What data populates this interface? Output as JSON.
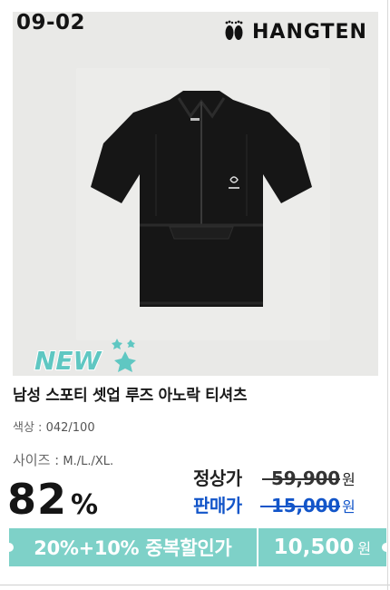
{
  "code": "09-02",
  "brand": {
    "name": "HANGTEN",
    "icon": "feet-logo-icon"
  },
  "badge": {
    "text": "NEW"
  },
  "product": {
    "title": "남성 스포티 셋업 루즈 아노락 티셔츠",
    "color_label": "색상 :",
    "color_value": "042/100",
    "size_label": "사이즈 :",
    "size_value": "M./L./XL."
  },
  "pricing": {
    "discount_value": "82",
    "discount_unit": "%",
    "regular_label": "정상가",
    "regular_price": "59,900",
    "sale_label": "판매가",
    "sale_price": "15,000",
    "currency": "원"
  },
  "coupon": {
    "text": "20%+10% 중복할인가",
    "final_price": "10,500",
    "currency": "원"
  },
  "colors": {
    "sale_blue": "#1255c9",
    "coupon_teal": "#7ed1c8",
    "new_badge_teal": "#5fc7c2"
  }
}
